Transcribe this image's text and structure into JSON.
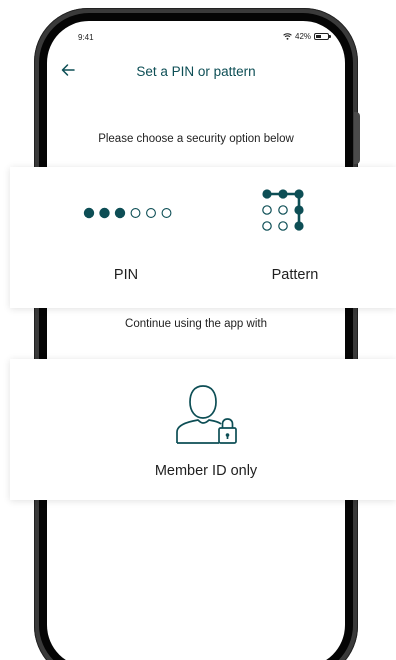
{
  "status_bar": {
    "time": "9:41",
    "battery_text": "42%",
    "battery_level": 0.42,
    "wifi_icon": "wifi-icon"
  },
  "header": {
    "back_icon": "arrow-left-icon",
    "title": "Set a PIN or pattern"
  },
  "prompt": "Please choose a security option below",
  "options": {
    "pin": {
      "label": "PIN",
      "icon": "pin-dots-icon",
      "filled_dots": 3,
      "total_dots": 6
    },
    "pattern": {
      "label": "Pattern",
      "icon": "pattern-grid-icon"
    }
  },
  "continue_text": "Continue using the app with",
  "member_option": {
    "label": "Member ID only",
    "icon": "person-lock-icon"
  },
  "colors": {
    "accent": "#0d4e55",
    "text": "#1f1f1f",
    "frame": "#3a3a3a"
  }
}
